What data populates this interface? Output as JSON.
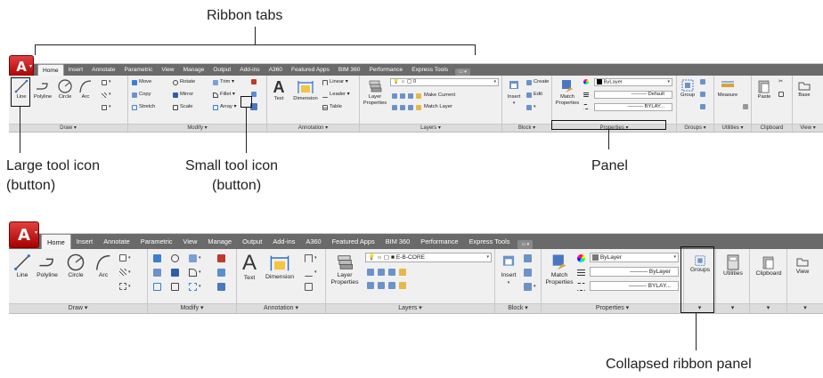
{
  "callouts": {
    "ribbon_tabs": "Ribbon tabs",
    "large_tool_line1": "Large tool icon",
    "large_tool_line2": "(button)",
    "small_tool_line1": "Small tool icon",
    "small_tool_line2": "(button)",
    "panel": "Panel",
    "collapsed": "Collapsed ribbon panel"
  },
  "ribbon1": {
    "tabs": [
      "Home",
      "Insert",
      "Annotate",
      "Parametric",
      "View",
      "Manage",
      "Output",
      "Add-ins",
      "A360",
      "Featured Apps",
      "BIM 360",
      "Performance",
      "Express Tools"
    ],
    "active_tab": "Home",
    "panel_titles": {
      "draw": "Draw ▾",
      "modify": "Modify ▾",
      "annotation": "Annotation ▾",
      "layers": "Layers ▾",
      "block": "Block ▾",
      "properties": "Properties ▾",
      "groups": "Groups ▾",
      "utilities": "Utilities ▾",
      "clipboard": "Clipboard",
      "view": "View ▾"
    },
    "draw_tools": [
      "Line",
      "Polyline",
      "Circle",
      "Arc"
    ],
    "modify_rows": [
      [
        "Move",
        "Rotate",
        "Trim ▾"
      ],
      [
        "Copy",
        "Mirror",
        "Fillet ▾"
      ],
      [
        "Stretch",
        "Scale",
        "Array ▾"
      ]
    ],
    "annotation": {
      "text": "Text",
      "dimension": "Dimension",
      "linear": "Linear ▾",
      "leader": "Leader ▾",
      "table": "Table"
    },
    "layers": {
      "props_1": "Layer",
      "props_2": "Properties",
      "current_layer": "0",
      "make_current": "Make Current",
      "match_layer": "Match Layer"
    },
    "block": {
      "insert": "Insert",
      "create": "Create",
      "edit": "Edit"
    },
    "properties": {
      "match_1": "Match",
      "match_2": "Properties",
      "color": "ByLayer",
      "lineweight": "Default",
      "linetype": "BYLAY..."
    },
    "groups": "Group",
    "utilities": "Measure",
    "clipboard": "Paste",
    "view": "Base"
  },
  "ribbon2": {
    "tabs": [
      "Home",
      "Insert",
      "Annotate",
      "Parametric",
      "View",
      "Manage",
      "Output",
      "Add-ins",
      "A360",
      "Featured Apps",
      "BIM 360",
      "Performance",
      "Express Tools"
    ],
    "active_tab": "Home",
    "panel_titles": {
      "draw": "Draw ▾",
      "modify": "Modify ▾",
      "annotation": "Annotation ▾",
      "layers": "Layers ▾",
      "block": "Block ▾",
      "properties": "Properties ▾"
    },
    "draw_tools": [
      "Line",
      "Polyline",
      "Circle",
      "Arc"
    ],
    "annotation": {
      "text": "Text",
      "dimension": "Dimension"
    },
    "layers": {
      "props_1": "Layer",
      "props_2": "Properties",
      "current_layer": "E-B-CORE"
    },
    "block": {
      "insert": "Insert"
    },
    "properties": {
      "match_1": "Match",
      "match_2": "Properties",
      "color": "ByLayer",
      "lineweight": "ByLayer",
      "linetype": "BYLAY..."
    },
    "collapsed": [
      "Groups",
      "Utilities",
      "Clipboard",
      "View"
    ]
  }
}
